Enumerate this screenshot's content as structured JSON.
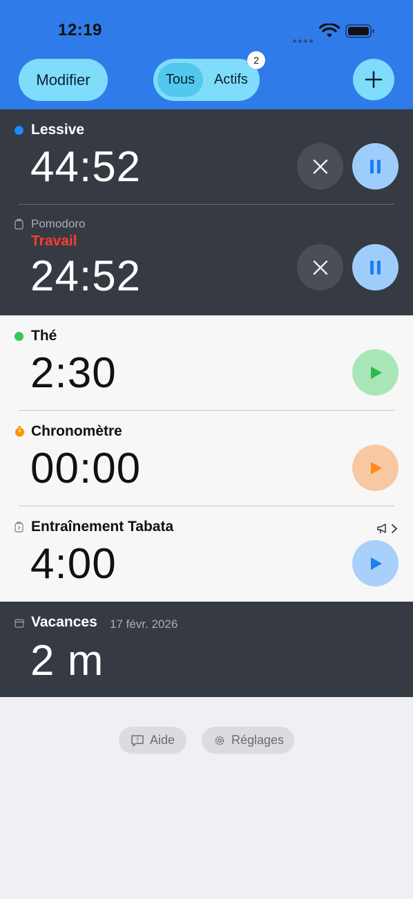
{
  "status_bar": {
    "time": "12:19"
  },
  "header": {
    "edit_label": "Modifier",
    "segments": [
      {
        "label": "Tous",
        "selected": true
      },
      {
        "label": "Actifs",
        "selected": false,
        "badge": "2"
      }
    ],
    "add_icon": "plus-icon"
  },
  "timers": [
    {
      "name": "Lessive",
      "time": "44:52",
      "dot_color": "#1a8cff",
      "state": "running"
    },
    {
      "kind": "Pomodoro",
      "phase": "Travail",
      "time": "24:52",
      "phase_color": "#ff3b30",
      "state": "running"
    },
    {
      "name": "Thé",
      "time": "2:30",
      "dot_color": "#34c759",
      "state": "stopped"
    },
    {
      "name": "Chronomètre",
      "time": "00:00",
      "dot_color": "#ff9500",
      "state": "stopped"
    },
    {
      "name": "Entraînement Tabata",
      "time": "4:00",
      "state": "stopped"
    },
    {
      "name": "Vacances",
      "date": "17 févr. 2026",
      "time": "2 m",
      "state": "countdown"
    }
  ],
  "footer": {
    "help_label": "Aide",
    "settings_label": "Réglages"
  },
  "colors": {
    "header_bg": "#2f7bea",
    "pill": "#7fdcfb",
    "dark_row": "#363a43",
    "light_row": "#f7f7f7"
  }
}
